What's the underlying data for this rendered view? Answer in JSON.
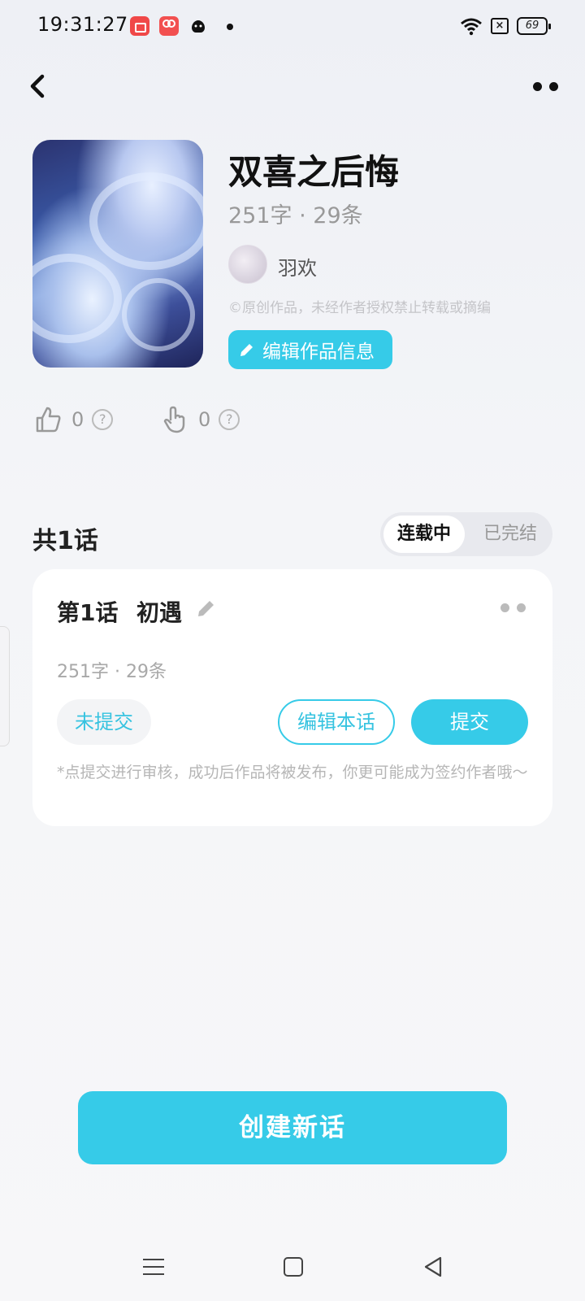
{
  "status_bar": {
    "time": "19:31:27",
    "battery": "69",
    "sim_label": "×"
  },
  "work": {
    "title": "双喜之后悔",
    "stats": "251字 · 29条",
    "author": "羽欢",
    "copyright": "©原创作品，未经作者授权禁止转载或摘编",
    "edit_info_label": "编辑作品信息"
  },
  "likes": [
    {
      "count": "0",
      "help": "?"
    },
    {
      "count": "0",
      "help": "?"
    }
  ],
  "episodes_header": {
    "count_label": "共1话",
    "status_options": [
      "连载中",
      "已完结"
    ],
    "selected": "连载中"
  },
  "episode": {
    "number": "第1话",
    "name": "初遇",
    "stats": "251字 · 29条",
    "status": "未提交",
    "edit_label": "编辑本话",
    "submit_label": "提交",
    "note": "*点提交进行审核，成功后作品将被发布，你更可能成为签约作者哦～"
  },
  "create_button": "创建新话",
  "colors": {
    "accent": "#36cbe8",
    "background": "#f4f5f8",
    "card": "#ffffff"
  }
}
